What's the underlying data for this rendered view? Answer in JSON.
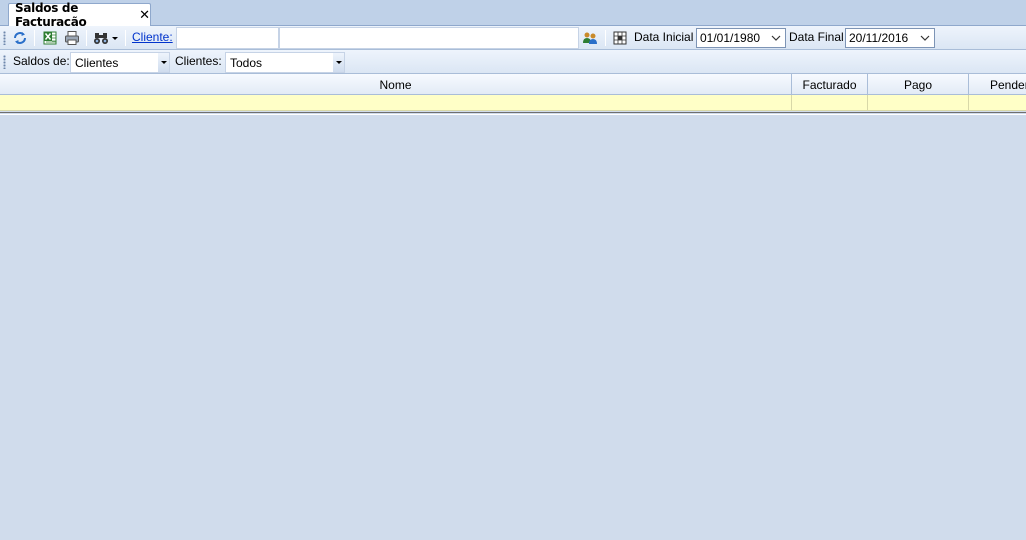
{
  "tab": {
    "title": "Saldos de Facturação",
    "close": "✕"
  },
  "toolbar": {
    "icons": [
      "refresh-icon",
      "excel-export-icon",
      "print-icon",
      "find-binoculars-icon",
      "dropdown-arrow-icon"
    ],
    "cliente_link": "Cliente:",
    "cliente_code": "",
    "cliente_name": "",
    "data_inicial_label": "Data Inicial",
    "data_inicial": "01/01/1980",
    "data_final_label": "Data Final",
    "data_final": "20/11/2016"
  },
  "filters": {
    "saldos_label": "Saldos de:",
    "saldos_value": "Clientes",
    "clientes_label": "Clientes:",
    "clientes_value": "Todos"
  },
  "grid": {
    "columns": [
      "Nome",
      "Facturado",
      "Pago",
      "Pendente"
    ],
    "rows": []
  },
  "colors": {
    "background": "#d0dcec",
    "filter_row": "#ffffc7",
    "link": "#0033cc"
  }
}
